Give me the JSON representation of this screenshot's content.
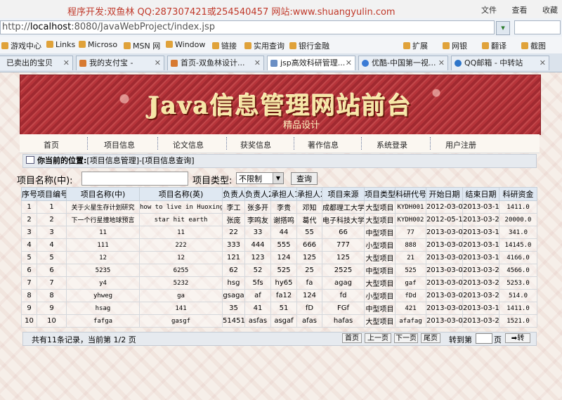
{
  "watermark": "程序开发:双鱼林 QQ:287307421或254540457 网站:www.shuangyulin.com",
  "browser_menu": [
    "文件",
    "查看",
    "收藏"
  ],
  "address": {
    "host": "localhost",
    "rest": ":8080/JavaWebProject/index.jsp",
    "prefix": "http://"
  },
  "favorites": [
    {
      "label": "游戏中心",
      "icon": "game-icon"
    },
    {
      "label": "Links",
      "icon": "folder-icon"
    },
    {
      "label": "Microso",
      "icon": "folder-icon"
    },
    {
      "label": "MSN 网",
      "icon": "folder-icon"
    },
    {
      "label": "Window",
      "icon": "folder-icon"
    },
    {
      "label": "链接",
      "icon": "folder-icon"
    },
    {
      "label": "实用查询",
      "icon": "folder-icon"
    },
    {
      "label": "银行金融",
      "icon": "folder-icon"
    },
    {
      "label": "扩展",
      "icon": "extension-icon"
    },
    {
      "label": "网银",
      "icon": "bank-icon"
    },
    {
      "label": "翻译",
      "icon": "translate-icon"
    },
    {
      "label": "截图",
      "icon": "screenshot-icon"
    }
  ],
  "tabs": [
    {
      "label": "已卖出的宝贝"
    },
    {
      "label": "我的支付宝 -"
    },
    {
      "label": "首页-双鱼林设计..."
    },
    {
      "label": "jsp高效科研管理..."
    },
    {
      "label": "优酷-中国第一视..."
    },
    {
      "label": "QQ邮箱 - 中转站"
    }
  ],
  "banner": {
    "title": "Java信息管理网站前台",
    "subtitle": "精品设计"
  },
  "nav": [
    "首页",
    "项目信息",
    "论文信息",
    "获奖信息",
    "著作信息",
    "系统登录",
    "用户注册"
  ],
  "location": {
    "label": "你当前的位置:",
    "path": "[项目信息管理]-[项目信息查询]"
  },
  "search": {
    "name_label": "项目名称(中):",
    "type_label": "项目类型:",
    "type_value": "不限制",
    "button": "查询"
  },
  "table": {
    "headers": [
      "序号",
      "项目编号",
      "项目名称(中)",
      "项目名称(英)",
      "负责人1",
      "负责人2",
      "承担人1",
      "承担人2",
      "项目来源",
      "项目类型",
      "科研代号",
      "开始日期",
      "结束日期",
      "科研资金"
    ],
    "rows": [
      [
        "1",
        "1",
        "关于火星生存计划研究",
        "how to live in Huoxing",
        "李工",
        "张多开",
        "李贵",
        "邓知",
        "成都理工大学",
        "大型项目",
        "KYDH001",
        "2012-03-01",
        "2013-03-14",
        "1411.0"
      ],
      [
        "2",
        "2",
        "下一个行星撞地球预言",
        "star hit earth",
        "张庞",
        "李鸣友",
        "谢搭鸣",
        "葛代",
        "电子科技大学",
        "大型项目",
        "KYDH002",
        "2012-05-16",
        "2013-03-21",
        "20000.0"
      ],
      [
        "3",
        "3",
        "11",
        "11",
        "22",
        "33",
        "44",
        "55",
        "66",
        "中型项目",
        "77",
        "2013-03-05",
        "2013-03-14",
        "341.0"
      ],
      [
        "4",
        "4",
        "111",
        "222",
        "333",
        "444",
        "555",
        "666",
        "777",
        "小型项目",
        "888",
        "2013-03-05",
        "2013-03-13",
        "14145.0"
      ],
      [
        "5",
        "5",
        "12",
        "12",
        "121",
        "123",
        "124",
        "125",
        "125",
        "大型项目",
        "21",
        "2013-03-05",
        "2013-03-11",
        "4166.0"
      ],
      [
        "6",
        "6",
        "5235",
        "6255",
        "62",
        "52",
        "525",
        "25",
        "2525",
        "中型项目",
        "525",
        "2013-03-05",
        "2013-03-21",
        "4566.0"
      ],
      [
        "7",
        "7",
        "y4",
        "5232",
        "hsg",
        "5fs",
        "hy65",
        "fa",
        "agag",
        "大型项目",
        "gaf",
        "2013-03-05",
        "2013-03-20",
        "5253.0"
      ],
      [
        "8",
        "8",
        "yhweg",
        "ga",
        "gsaga",
        "af",
        "fa12",
        "124",
        "fd",
        "小型项目",
        "fDd",
        "2013-03-04",
        "2013-03-20",
        "514.0"
      ],
      [
        "9",
        "9",
        "hsag",
        "141",
        "35",
        "41",
        "51",
        "fD",
        "FGf",
        "中型项目",
        "421",
        "2013-03-01",
        "2013-03-15",
        "1411.0"
      ],
      [
        "10",
        "10",
        "fafga",
        "gasgf",
        "51451",
        "asfas",
        "asgaf",
        "afas",
        "hafas",
        "大型项目",
        "afafag",
        "2013-03-04",
        "2013-03-22",
        "1521.0"
      ]
    ]
  },
  "pager": {
    "summary": "共有11条记录，当前第 1/2 页",
    "first": "首页",
    "prev": "上一页",
    "next": "下一页",
    "last": "尾页",
    "goto_label": "转到第",
    "goto_unit": "页",
    "go": "转"
  }
}
